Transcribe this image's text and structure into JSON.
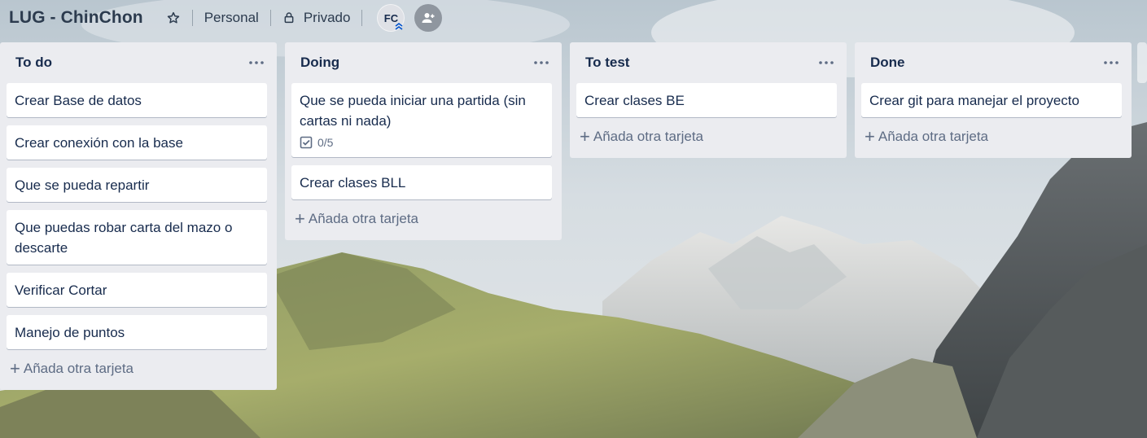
{
  "header": {
    "board_title": "LUG - ChinChon",
    "workspace_label": "Personal",
    "visibility_label": "Privado",
    "member_initials": "FC"
  },
  "lists": [
    {
      "title": "To do",
      "cards": [
        {
          "title": "Crear Base de datos"
        },
        {
          "title": "Crear conexión con la base"
        },
        {
          "title": "Que se pueda repartir"
        },
        {
          "title": "Que puedas robar carta del mazo o descarte"
        },
        {
          "title": "Verificar Cortar"
        },
        {
          "title": "Manejo de puntos"
        }
      ],
      "add_card_label": "Añada otra tarjeta"
    },
    {
      "title": "Doing",
      "cards": [
        {
          "title": "Que se pueda iniciar una partida (sin cartas ni nada)",
          "checklist": "0/5"
        },
        {
          "title": "Crear clases BLL"
        }
      ],
      "add_card_label": "Añada otra tarjeta"
    },
    {
      "title": "To test",
      "cards": [
        {
          "title": "Crear clases BE"
        }
      ],
      "add_card_label": "Añada otra tarjeta"
    },
    {
      "title": "Done",
      "cards": [
        {
          "title": "Crear git para manejar el proyecto"
        }
      ],
      "add_card_label": "Añada otra tarjeta"
    }
  ],
  "icons": {
    "star": "star-icon",
    "lock": "lock-icon",
    "add_member": "add-member-icon",
    "list_menu": "ellipsis-icon",
    "checklist": "checklist-icon",
    "plus": "plus-icon"
  },
  "colors": {
    "list_bg": "#ebecf0",
    "card_bg": "#ffffff",
    "text": "#172b4d",
    "muted": "#5e6c84"
  }
}
